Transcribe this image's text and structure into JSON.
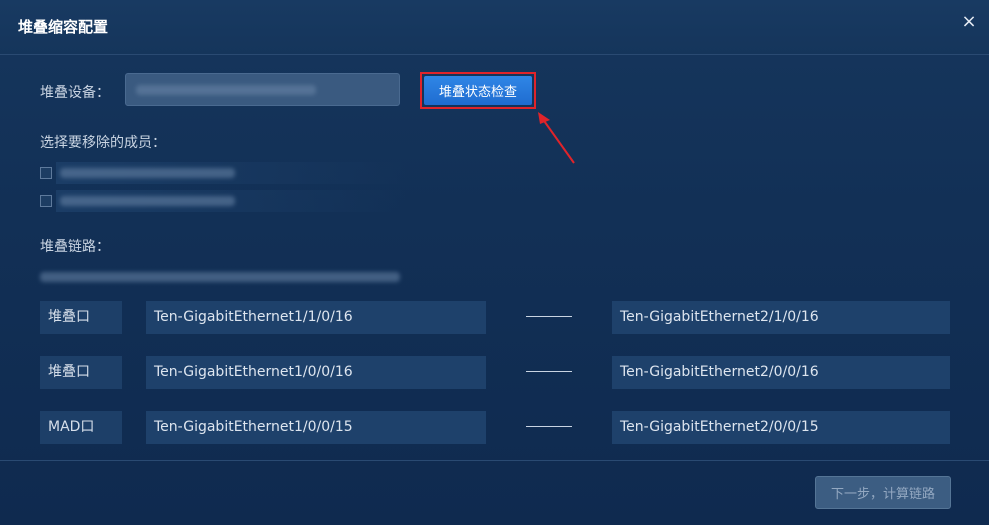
{
  "dialog": {
    "title": "堆叠缩容配置",
    "close_label": "×"
  },
  "device": {
    "label": "堆叠设备：",
    "value": "",
    "check_button_label": "堆叠状态检查"
  },
  "members": {
    "label": "选择要移除的成员：",
    "items": [
      {
        "checked": false
      },
      {
        "checked": false
      }
    ]
  },
  "links": {
    "label": "堆叠链路：",
    "rows": [
      {
        "type": "堆叠口",
        "left": "Ten-GigabitEthernet1/1/0/16",
        "right": "Ten-GigabitEthernet2/1/0/16"
      },
      {
        "type": "堆叠口",
        "left": "Ten-GigabitEthernet1/0/0/16",
        "right": "Ten-GigabitEthernet2/0/0/16"
      },
      {
        "type": "MAD口",
        "left": "Ten-GigabitEthernet1/0/0/15",
        "right": "Ten-GigabitEthernet2/0/0/15"
      }
    ]
  },
  "footer": {
    "next_button_label": "下一步，计算链路"
  },
  "colors": {
    "accent": "#2f86e6",
    "highlight": "#e0242a"
  }
}
